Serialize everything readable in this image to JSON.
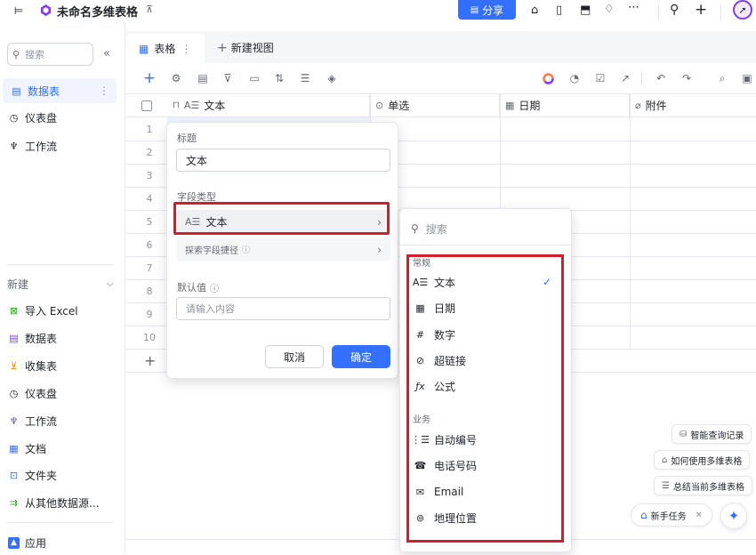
{
  "app": {
    "title": "未命名多维表格",
    "share_label": "分享"
  },
  "sidebar": {
    "search_placeholder": "搜索",
    "tables": [
      {
        "label": "数据表",
        "icon": "table-icon",
        "active": true
      },
      {
        "label": "仪表盘",
        "icon": "dashboard-icon"
      },
      {
        "label": "工作流",
        "icon": "workflow-icon"
      }
    ],
    "new_section_label": "新建",
    "new_items": [
      {
        "label": "导入 Excel",
        "icon": "excel-icon",
        "color": "#2ea121"
      },
      {
        "label": "数据表",
        "icon": "table-icon",
        "color": "#7f3bf5"
      },
      {
        "label": "收集表",
        "icon": "form-icon",
        "color": "#ff8800"
      },
      {
        "label": "仪表盘",
        "icon": "dashboard-icon",
        "color": "#1f2329"
      },
      {
        "label": "工作流",
        "icon": "workflow-icon",
        "color": "#7f3bf5"
      },
      {
        "label": "文档",
        "icon": "doc-icon",
        "color": "#3370ff"
      },
      {
        "label": "文件夹",
        "icon": "folder-icon",
        "color": "#3370ff"
      },
      {
        "label": "从其他数据源...",
        "icon": "datasource-icon",
        "color": "#2ea121"
      }
    ],
    "apps_label": "应用"
  },
  "tabs": {
    "grid_label": "表格",
    "new_view_label": "新建视图"
  },
  "grid": {
    "columns": [
      {
        "label": "文本",
        "icon": "text-icon"
      },
      {
        "label": "单选",
        "icon": "single-select-icon"
      },
      {
        "label": "日期",
        "icon": "date-icon"
      },
      {
        "label": "附件",
        "icon": "attachment-icon"
      }
    ],
    "rows": [
      "1",
      "2",
      "3",
      "4",
      "5",
      "6",
      "7",
      "8",
      "9",
      "10"
    ]
  },
  "field_editor": {
    "title_label": "标题",
    "title_value": "文本",
    "type_label": "字段类型",
    "type_value": "文本",
    "search_shortcut_label": "探索字段捷径",
    "default_label": "默认值",
    "default_placeholder": "请输入内容",
    "cancel_label": "取消",
    "confirm_label": "确定"
  },
  "type_menu": {
    "search_placeholder": "搜索",
    "group_common": "常规",
    "common_items": [
      {
        "label": "文本",
        "icon": "text-icon",
        "checked": true
      },
      {
        "label": "日期",
        "icon": "date-icon"
      },
      {
        "label": "数字",
        "icon": "number-icon"
      },
      {
        "label": "超链接",
        "icon": "link-icon"
      },
      {
        "label": "公式",
        "icon": "formula-icon"
      }
    ],
    "group_business": "业务",
    "business_items": [
      {
        "label": "自动编号",
        "icon": "autonumber-icon"
      },
      {
        "label": "电话号码",
        "icon": "phone-icon"
      },
      {
        "label": "Email",
        "icon": "email-icon"
      },
      {
        "label": "地理位置",
        "icon": "location-icon"
      }
    ]
  },
  "assistant": {
    "query_history": "智能查询记录",
    "how_to_use": "如何使用多维表格",
    "summarize": "总结当前多维表格",
    "newbie_task": "新手任务"
  },
  "colors": {
    "accent": "#3370ff",
    "highlight": "#d11d2c"
  }
}
